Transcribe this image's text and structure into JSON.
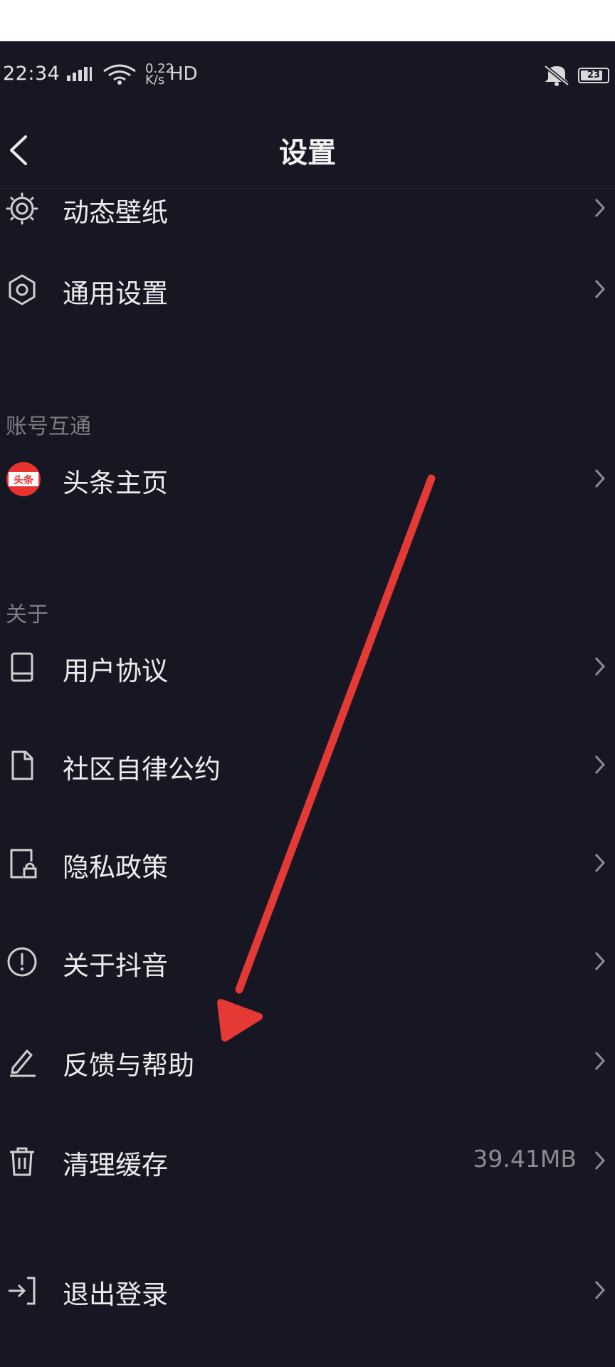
{
  "status_bar": {
    "time": "22:34",
    "net_speed_line1": "0.22",
    "net_speed_line2": "K/s",
    "hd_label": "HD",
    "battery": "23"
  },
  "header": {
    "title": "设置"
  },
  "rows": {
    "dynamic_wallpaper": "动态壁纸",
    "general_settings": "通用设置",
    "toutiao_home": "头条主页",
    "toutiao_logo_text": "头条",
    "user_agreement": "用户协议",
    "community_convention": "社区自律公约",
    "privacy_policy": "隐私政策",
    "about_douyin": "关于抖音",
    "feedback_help": "反馈与帮助",
    "clear_cache": "清理缓存",
    "cache_size": "39.41MB",
    "logout": "退出登录"
  },
  "sections": {
    "account_interop": "账号互通",
    "about": "关于"
  },
  "colors": {
    "background": "#161722",
    "text": "#ececec",
    "secondary_text": "#7d7e85",
    "annotation_arrow": "#e53935",
    "toutiao_red": "#e8322e"
  },
  "icons": {
    "wallpaper": "wallpaper-icon",
    "settings": "gear-icon",
    "toutiao": "toutiao-logo",
    "agreement": "book-icon",
    "convention": "document-icon",
    "privacy": "lock-document-icon",
    "about": "info-icon",
    "feedback": "pencil-icon",
    "cache": "trash-icon",
    "logout": "logout-icon"
  }
}
